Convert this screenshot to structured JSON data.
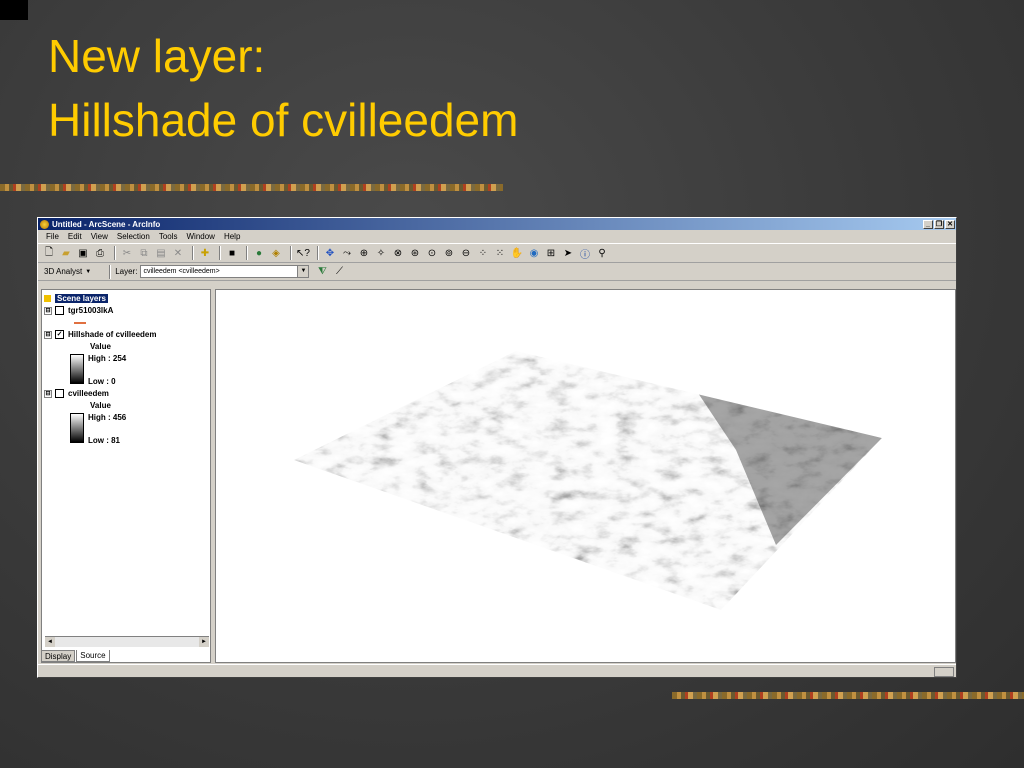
{
  "slide": {
    "title_line1": "New layer:",
    "title_line2": "Hillshade of cvilleedem"
  },
  "window": {
    "title": "Untitled - ArcScene - ArcInfo",
    "controls": [
      "_",
      "❐",
      "✕"
    ],
    "menu": [
      "File",
      "Edit",
      "View",
      "Selection",
      "Tools",
      "Window",
      "Help"
    ],
    "toolbar_icons": [
      "new-icon",
      "open-icon",
      "save-icon",
      "print-icon",
      "cut-icon",
      "copy-icon",
      "paste-icon",
      "delete-icon",
      "add-data-icon",
      "full-screen-icon",
      "scene-properties-icon",
      "animation-icon",
      "whats-this-icon",
      "navigate-icon",
      "fly-icon",
      "target-zoom-icon",
      "center-target-icon",
      "zoom-target-icon",
      "set-observer-icon",
      "zoom-in-out-icon",
      "zoom-in-icon",
      "zoom-out-icon",
      "full-extent-icon",
      "zoom-layer-icon",
      "pan-icon",
      "globe-icon",
      "identify-icon",
      "select-icon",
      "info-icon",
      "find-icon"
    ],
    "analyst_label": "3D Analyst",
    "layer_label": "Layer:",
    "layer_value": "cvilleedem <cvilleedem>"
  },
  "toc": {
    "root": "Scene layers",
    "layers": [
      {
        "name": "tgr51003lkA",
        "checked": false
      },
      {
        "name": "Hillshade of cvilleedem",
        "checked": true,
        "legend_title": "Value",
        "high": "High : 254",
        "low": "Low : 0"
      },
      {
        "name": "cvilleedem",
        "checked": false,
        "legend_title": "Value",
        "high": "High : 456",
        "low": "Low : 81"
      }
    ],
    "tabs": [
      "Display",
      "Source"
    ]
  },
  "colors": {
    "title": "#ffcc00",
    "background": "#3c3c3c",
    "line_symbol": "#e07040"
  }
}
